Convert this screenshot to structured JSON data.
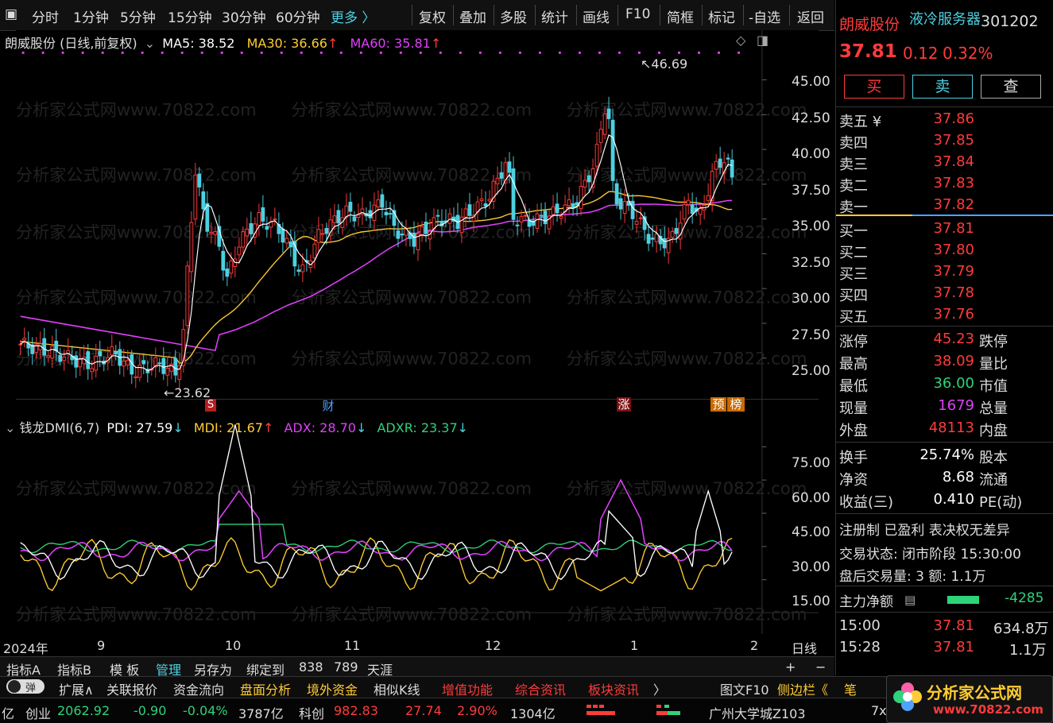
{
  "toolbar": {
    "items": [
      "分时",
      "1分钟",
      "5分钟",
      "15分钟",
      "30分钟",
      "60分钟",
      "更多 〉",
      "复权",
      "叠加",
      "多股",
      "统计",
      "画线",
      "F10",
      "简框",
      "标记",
      "-自选",
      "返回"
    ]
  },
  "main_chart": {
    "title": "朗威股份 (日线,前复权)",
    "ma5": "MA5: 38.52",
    "ma30": "MA30: 36.66",
    "ma60": "MA60: 35.81",
    "high_label": "46.69",
    "low_label": "23.62",
    "y_ticks": [
      "45.00",
      "42.50",
      "40.00",
      "37.50",
      "35.00",
      "32.50",
      "30.00",
      "27.50",
      "25.00"
    ],
    "events": [
      "S",
      "财",
      "涨",
      "预",
      "榜"
    ]
  },
  "indicator": {
    "name": "钱龙DMI(6,7)",
    "pdi": "PDI: 27.59",
    "mdi": "MDI: 21.67",
    "adx": "ADX: 28.70",
    "adxr": "ADXR: 23.37",
    "y_ticks": [
      "75.00",
      "60.00",
      "45.00",
      "30.00",
      "15.00"
    ]
  },
  "x_axis": {
    "labels": [
      "2024年",
      "9",
      "10",
      "11",
      "12",
      "1",
      "2"
    ],
    "period": "日线"
  },
  "tabs_row1": [
    "指标A",
    "指标B",
    "模 板",
    "管理",
    "另存为",
    "绑定到",
    "838",
    "789",
    "天涯"
  ],
  "tabs_row2": [
    "扩展∧",
    "关联报价",
    "资金流向",
    "盘面分析",
    "境外资金",
    "相似K线",
    "增值功能",
    "综合资讯",
    "板块资讯",
    "〉",
    "图文F10",
    "侧边栏《",
    "笔"
  ],
  "toggle_label": "弹",
  "side": {
    "name": "朗威股份",
    "concept": "液冷服务器",
    "code": "301202",
    "price": "37.81",
    "change": "0.12",
    "pct": "0.32%",
    "buttons": [
      "买",
      "卖",
      "查"
    ],
    "asks": [
      {
        "label": "卖五 ¥",
        "price": "37.86"
      },
      {
        "label": "卖四",
        "price": "37.85"
      },
      {
        "label": "卖三",
        "price": "37.84"
      },
      {
        "label": "卖二",
        "price": "37.83"
      },
      {
        "label": "卖一",
        "price": "37.82"
      }
    ],
    "bids": [
      {
        "label": "买一",
        "price": "37.81"
      },
      {
        "label": "买二",
        "price": "37.80"
      },
      {
        "label": "买三",
        "price": "37.79"
      },
      {
        "label": "买四",
        "price": "37.78"
      },
      {
        "label": "买五",
        "price": "37.76"
      }
    ],
    "stats": [
      {
        "l": "涨停",
        "v": "45.23",
        "r": "跌停"
      },
      {
        "l": "最高",
        "v": "38.09",
        "r": "量比"
      },
      {
        "l": "最低",
        "v": "36.00",
        "r": "市值"
      },
      {
        "l": "现量",
        "v": "1679",
        "r": "总量"
      },
      {
        "l": "外盘",
        "v": "48113",
        "r": "内盘"
      }
    ],
    "stats2": [
      {
        "l": "换手",
        "v": "25.74%",
        "r": "股本"
      },
      {
        "l": "净资",
        "v": "8.68",
        "r": "流通"
      },
      {
        "l": "收益(三)",
        "v": "0.410",
        "r": "PE(动)"
      }
    ],
    "reg": "注册制 已盈利 表决权无差异",
    "trade_status": "交易状态: 闭市阶段 15:30:00",
    "after_hours": "盘后交易量: 3  额: 1.1万",
    "main_flow_label": "主力净额",
    "main_flow_value": "-4285",
    "ticks": [
      {
        "t": "15:00",
        "p": "37.81",
        "v": "634.8万"
      },
      {
        "t": "15:28",
        "p": "37.81",
        "v": "1.1万"
      }
    ]
  },
  "status_bar": {
    "a0": "亿",
    "a1": "创业",
    "a2": "2062.92",
    "a3": "-0.90",
    "a4": "-0.04%",
    "a5": "3787亿",
    "b1": "科创",
    "b2": "982.83",
    "b3": "27.74",
    "b4": "2.90%",
    "b5": "1304亿",
    "c1": "广州大学城Z103",
    "c2": "7x"
  },
  "logo": {
    "text": "分析家公式网",
    "url": "www.70822.com"
  },
  "watermark": "分析家公式网www.70822.com",
  "colors": {
    "up": "#ff3b3b",
    "down": "#4dd0e1",
    "ma5": "#ffffff",
    "ma30": "#ffcc33",
    "ma60": "#e040fb",
    "pdi": "#ffffff",
    "mdi": "#ffcc33",
    "adx": "#e040fb",
    "adxr": "#2ed27a"
  }
}
